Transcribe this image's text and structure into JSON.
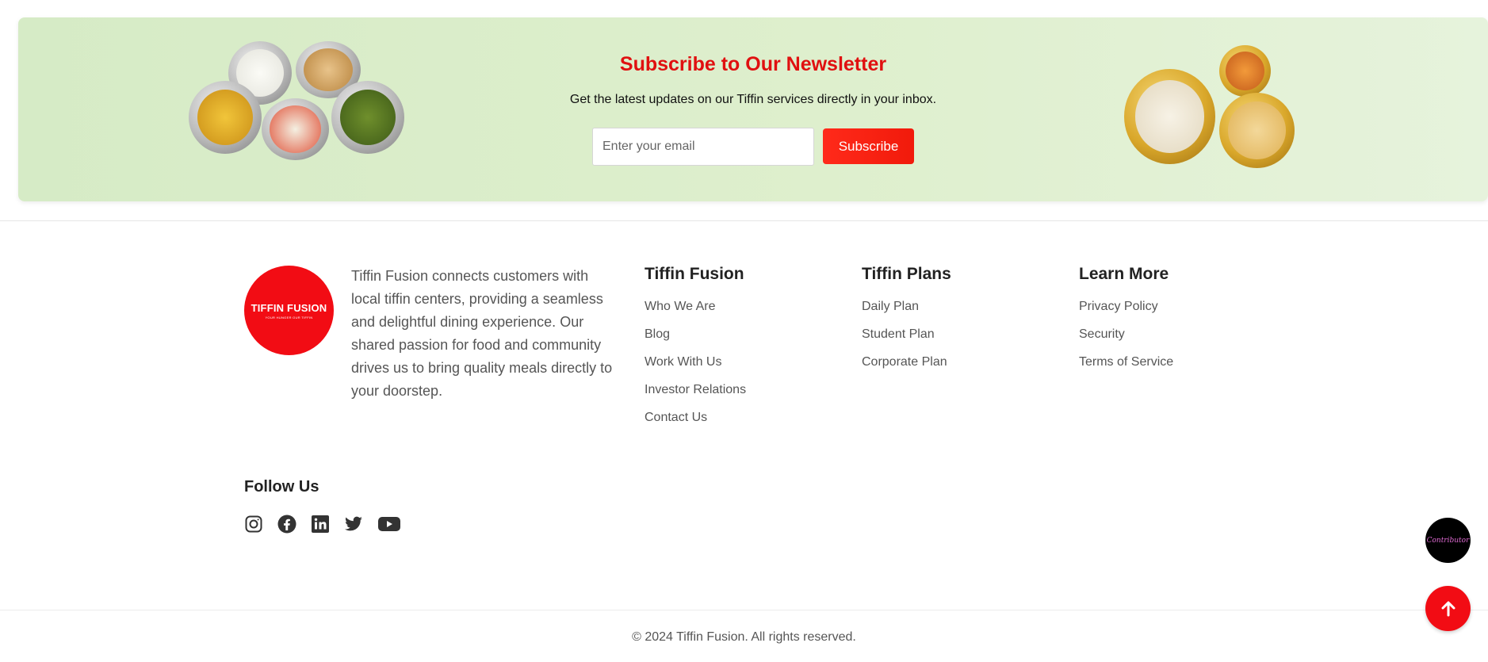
{
  "newsletter": {
    "title": "Subscribe to Our Newsletter",
    "subtitle": "Get the latest updates on our Tiffin services directly in your inbox.",
    "email_placeholder": "Enter your email",
    "subscribe_label": "Subscribe"
  },
  "brand": {
    "logo_name": "TIFFIN FUSION",
    "logo_tagline": "YOUR HUNGER OUR TIFFIN",
    "about": "Tiffin Fusion connects customers with local tiffin centers, providing a seamless and delightful dining experience. Our shared passion for food and community drives us to bring quality meals directly to your doorstep."
  },
  "columns": [
    {
      "title": "Tiffin Fusion",
      "links": [
        "Who We Are",
        "Blog",
        "Work With Us",
        "Investor Relations",
        "Contact Us"
      ]
    },
    {
      "title": "Tiffin Plans",
      "links": [
        "Daily Plan",
        "Student Plan",
        "Corporate Plan"
      ]
    },
    {
      "title": "Learn More",
      "links": [
        "Privacy Policy",
        "Security",
        "Terms of Service"
      ]
    }
  ],
  "follow": {
    "title": "Follow Us",
    "icons": [
      "instagram-icon",
      "facebook-icon",
      "linkedin-icon",
      "twitter-icon",
      "youtube-icon"
    ]
  },
  "footer": {
    "copyright": "© 2024 Tiffin Fusion. All rights reserved."
  },
  "floating": {
    "contributor_label": "Contributor"
  },
  "colors": {
    "accent": "#f20c14",
    "title_red": "#e01010",
    "newsletter_bg": "#d9ecc8"
  }
}
